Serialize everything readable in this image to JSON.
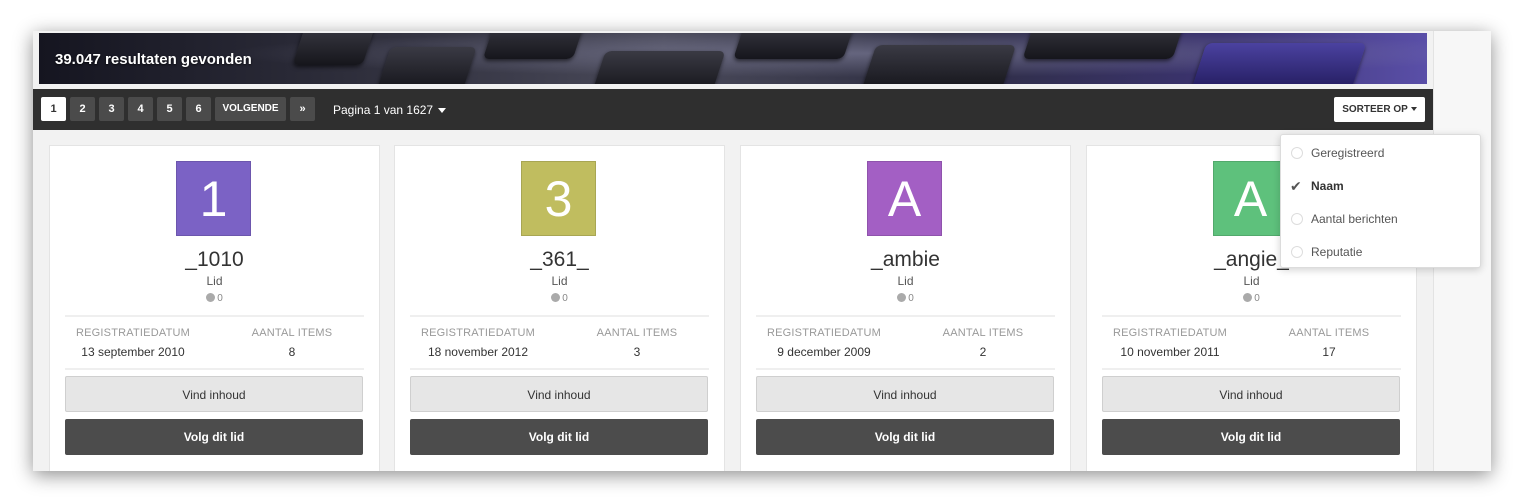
{
  "banner": {
    "title": "39.047 resultaten gevonden"
  },
  "pagination": {
    "pages": [
      "1",
      "2",
      "3",
      "4",
      "5",
      "6"
    ],
    "active_page": "1",
    "next_label": "VOLGENDE",
    "last_label": "»",
    "page_info": "Pagina 1 van 1627"
  },
  "sort": {
    "button_label": "SORTEER OP",
    "options": [
      {
        "label": "Geregistreerd",
        "selected": false
      },
      {
        "label": "Naam",
        "selected": true
      },
      {
        "label": "Aantal berichten",
        "selected": false
      },
      {
        "label": "Reputatie",
        "selected": false
      }
    ]
  },
  "stat_labels": {
    "registration": "REGISTRATIEDATUM",
    "items": "AANTAL ITEMS"
  },
  "buttons": {
    "find_content": "Vind inhoud",
    "follow": "Volg dit lid"
  },
  "members": [
    {
      "initial": "1",
      "avatar_color": "#7b62c5",
      "name": "_1010",
      "role": "Lid",
      "reputation": "0",
      "registered": "13 september 2010",
      "items": "8"
    },
    {
      "initial": "3",
      "avatar_color": "#c0bd5f",
      "name": "_361_",
      "role": "Lid",
      "reputation": "0",
      "registered": "18 november 2012",
      "items": "3"
    },
    {
      "initial": "A",
      "avatar_color": "#a35fc4",
      "name": "_ambie",
      "role": "Lid",
      "reputation": "0",
      "registered": "9 december 2009",
      "items": "2"
    },
    {
      "initial": "A",
      "avatar_color": "#5ec17c",
      "name": "_angie_",
      "role": "Lid",
      "reputation": "0",
      "registered": "10 november 2011",
      "items": "17"
    }
  ]
}
